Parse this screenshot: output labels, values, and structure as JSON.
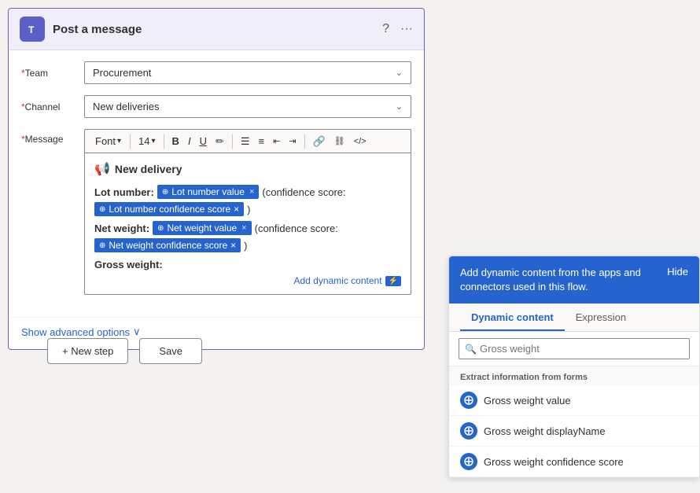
{
  "header": {
    "title": "Post a message",
    "teams_icon_letter": "T"
  },
  "form": {
    "team_label": "Team",
    "team_required": true,
    "team_value": "Procurement",
    "channel_label": "Channel",
    "channel_required": true,
    "channel_value": "New deliveries",
    "message_label": "Message",
    "message_required": true
  },
  "toolbar": {
    "font_label": "Font",
    "font_size": "14",
    "bold": "B",
    "italic": "I",
    "underline": "U",
    "highlight": "✏",
    "bullet_list": "≡",
    "number_list": "≡",
    "outdent": "≪",
    "indent": "≫",
    "link": "🔗",
    "remove_link": "⛓",
    "code": "</>",
    "font_chevron": "▾",
    "size_chevron": "▾"
  },
  "editor": {
    "announcement_icon": "📢",
    "announcement_text": "New delivery",
    "lot_number_label": "Lot number:",
    "lot_value_tag": "Lot number value",
    "confidence_score_text": "(confidence score:",
    "lot_confidence_tag": "Lot number confidence score",
    "close_paren": ")",
    "net_weight_label": "Net weight:",
    "net_value_tag": "Net weight value",
    "net_confidence_tag": "Net weight confidence score",
    "gross_weight_label": "Gross weight:",
    "add_dynamic_label": "Add dynamic content",
    "dynamic_badge": "⚡"
  },
  "advanced_options": {
    "label": "Show advanced options",
    "chevron": "∨"
  },
  "actions": {
    "new_step_label": "+ New step",
    "save_label": "Save"
  },
  "dynamic_panel": {
    "header_text": "Add dynamic content from the apps and connectors used in this flow.",
    "hide_label": "Hide",
    "tab_dynamic": "Dynamic content",
    "tab_expression": "Expression",
    "search_placeholder": "Gross weight",
    "section_label": "Extract information from forms",
    "items": [
      {
        "label": "Gross weight value"
      },
      {
        "label": "Gross weight displayName"
      },
      {
        "label": "Gross weight confidence score"
      }
    ]
  }
}
